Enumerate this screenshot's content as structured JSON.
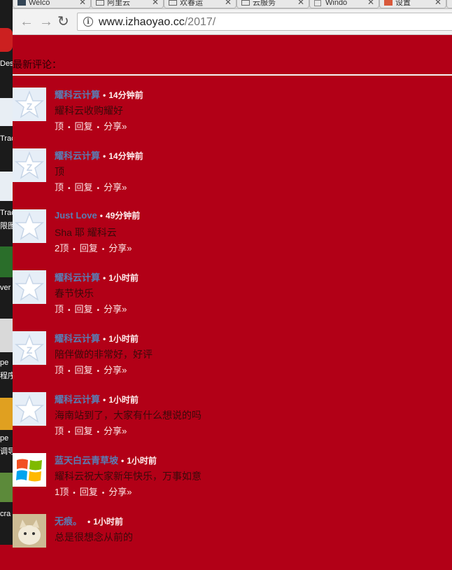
{
  "browser": {
    "tabs": [
      {
        "label": "Welco"
      },
      {
        "label": "阿里云"
      },
      {
        "label": "欢春运"
      },
      {
        "label": "云服务"
      },
      {
        "label": "Windo"
      },
      {
        "label": "设置"
      }
    ],
    "url_host": "www.izhaoyao.cc",
    "url_path": "/2017/"
  },
  "desktop": {
    "labels": [
      "Des",
      "Trac",
      "Trac",
      "限图",
      "ver",
      "pe",
      "程序",
      "pe",
      "调导",
      "cra"
    ]
  },
  "page": {
    "heading": "最新评论：",
    "comments": [
      {
        "author": "耀科云计算",
        "time": "14分钟前",
        "body": "耀科云收购耀好",
        "likes": "顶",
        "reply": "回复",
        "share": "分享»"
      },
      {
        "author": "耀科云计算",
        "time": "14分钟前",
        "body": "顶",
        "likes": "顶",
        "reply": "回复",
        "share": "分享»"
      },
      {
        "author": "Just Love",
        "time": "49分钟前",
        "body": "Sha 耶 耀科云",
        "likes": "2顶",
        "reply": "回复",
        "share": "分享»"
      },
      {
        "author": "耀科云计算",
        "time": "1小时前",
        "body": "春节快乐",
        "likes": "顶",
        "reply": "回复",
        "share": "分享»"
      },
      {
        "author": "耀科云计算",
        "time": "1小时前",
        "body": "陪伴做的非常好，好评",
        "likes": "顶",
        "reply": "回复",
        "share": "分享»"
      },
      {
        "author": "耀科云计算",
        "time": "1小时前",
        "body": "海南站到了，大家有什么想说的吗",
        "likes": "顶",
        "reply": "回复",
        "share": "分享»"
      },
      {
        "author": "蓝天白云青草坡",
        "time": "1小时前",
        "body": "耀科云祝大家新年快乐，万事如意",
        "likes": "1顶",
        "reply": "回复",
        "share": "分享»"
      },
      {
        "author": "无痕。",
        "time": "1小时前",
        "body": "总是很想念从前的",
        "likes": "",
        "reply": "",
        "share": ""
      }
    ]
  }
}
